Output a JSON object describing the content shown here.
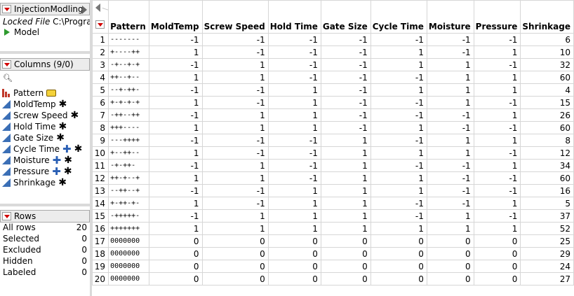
{
  "table_panel": {
    "title": "InjectionModling",
    "locked_label": "Locked File",
    "locked_path": "C:\\Program",
    "script_label": "Model"
  },
  "columns_panel": {
    "title": "Columns (9/0)",
    "search_icon": "search-icon",
    "items": [
      {
        "name": "Pattern",
        "type": "nominal",
        "tag": true,
        "plus": false,
        "star": false
      },
      {
        "name": "MoldTemp",
        "type": "continuous",
        "tag": false,
        "plus": false,
        "star": true
      },
      {
        "name": "Screw Speed",
        "type": "continuous",
        "tag": false,
        "plus": false,
        "star": true
      },
      {
        "name": "Hold Time",
        "type": "continuous",
        "tag": false,
        "plus": false,
        "star": true
      },
      {
        "name": "Gate Size",
        "type": "continuous",
        "tag": false,
        "plus": false,
        "star": true
      },
      {
        "name": "Cycle Time",
        "type": "continuous",
        "tag": false,
        "plus": true,
        "star": true
      },
      {
        "name": "Moisture",
        "type": "continuous",
        "tag": false,
        "plus": true,
        "star": true
      },
      {
        "name": "Pressure",
        "type": "continuous",
        "tag": false,
        "plus": true,
        "star": true
      },
      {
        "name": "Shrinkage",
        "type": "continuous",
        "tag": false,
        "plus": false,
        "star": true
      }
    ]
  },
  "rows_panel": {
    "title": "Rows",
    "items": [
      {
        "label": "All rows",
        "value": "20"
      },
      {
        "label": "Selected",
        "value": "0"
      },
      {
        "label": "Excluded",
        "value": "0"
      },
      {
        "label": "Hidden",
        "value": "0"
      },
      {
        "label": "Labeled",
        "value": "0"
      }
    ]
  },
  "grid": {
    "headers": [
      "Pattern",
      "MoldTemp",
      "Screw Speed",
      "Hold Time",
      "Gate Size",
      "Cycle Time",
      "Moisture",
      "Pressure",
      "Shrinkage"
    ],
    "rows": [
      [
        "1",
        "-------",
        "-1",
        "-1",
        "-1",
        "-1",
        "-1",
        "-1",
        "-1",
        "6"
      ],
      [
        "2",
        "+----++",
        "1",
        "-1",
        "-1",
        "-1",
        "1",
        "-1",
        "1",
        "10"
      ],
      [
        "3",
        "-+--+-+",
        "-1",
        "1",
        "-1",
        "-1",
        "1",
        "1",
        "-1",
        "32"
      ],
      [
        "4",
        "++--+--",
        "1",
        "1",
        "-1",
        "-1",
        "-1",
        "1",
        "1",
        "60"
      ],
      [
        "5",
        "--+-++-",
        "-1",
        "-1",
        "1",
        "-1",
        "1",
        "1",
        "1",
        "4"
      ],
      [
        "6",
        "+-+-+-+",
        "1",
        "-1",
        "1",
        "-1",
        "-1",
        "1",
        "-1",
        "15"
      ],
      [
        "7",
        "-++--++",
        "-1",
        "1",
        "1",
        "-1",
        "-1",
        "-1",
        "1",
        "26"
      ],
      [
        "8",
        "+++----",
        "1",
        "1",
        "1",
        "-1",
        "1",
        "-1",
        "-1",
        "60"
      ],
      [
        "9",
        "---++++",
        "-1",
        "-1",
        "-1",
        "1",
        "-1",
        "1",
        "1",
        "8"
      ],
      [
        "10",
        "+--++--",
        "1",
        "-1",
        "-1",
        "1",
        "1",
        "1",
        "-1",
        "12"
      ],
      [
        "11",
        "-+-++-",
        "-1",
        "1",
        "-1",
        "1",
        "-1",
        "-1",
        "1",
        "34"
      ],
      [
        "12",
        "++-+--+",
        "1",
        "1",
        "-1",
        "1",
        "1",
        "-1",
        "-1",
        "60"
      ],
      [
        "13",
        "--++--+",
        "-1",
        "-1",
        "1",
        "1",
        "1",
        "-1",
        "-1",
        "16"
      ],
      [
        "14",
        "+-++-+-",
        "1",
        "-1",
        "1",
        "1",
        "-1",
        "-1",
        "1",
        "5"
      ],
      [
        "15",
        "-+++++-",
        "-1",
        "1",
        "1",
        "1",
        "-1",
        "1",
        "-1",
        "37"
      ],
      [
        "16",
        "+++++++",
        "1",
        "1",
        "1",
        "1",
        "1",
        "1",
        "1",
        "52"
      ],
      [
        "17",
        "0000000",
        "0",
        "0",
        "0",
        "0",
        "0",
        "0",
        "0",
        "25"
      ],
      [
        "18",
        "0000000",
        "0",
        "0",
        "0",
        "0",
        "0",
        "0",
        "0",
        "29"
      ],
      [
        "19",
        "0000000",
        "0",
        "0",
        "0",
        "0",
        "0",
        "0",
        "0",
        "24"
      ],
      [
        "20",
        "0000000",
        "0",
        "0",
        "0",
        "0",
        "0",
        "0",
        "0",
        "27"
      ]
    ]
  }
}
